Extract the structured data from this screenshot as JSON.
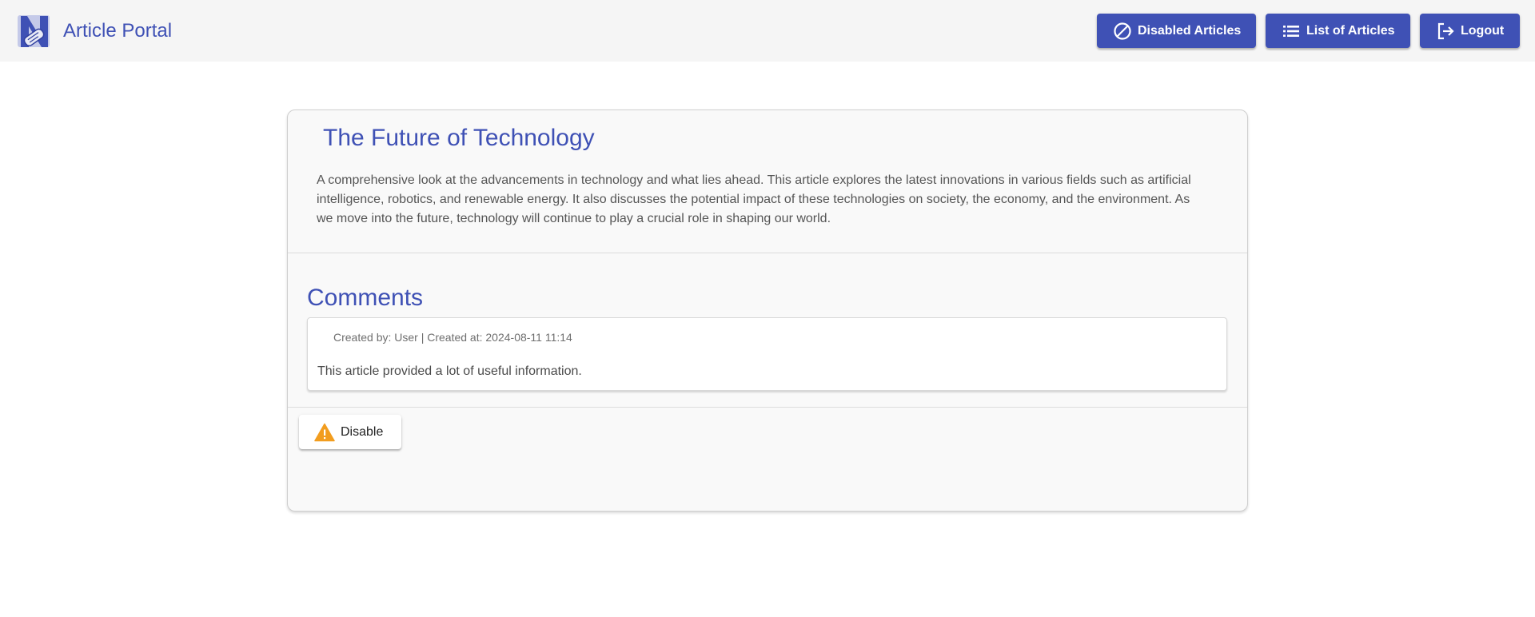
{
  "header": {
    "title": "Article Portal",
    "logo_icon": "newspaper-logo-icon",
    "accent_color": "#3f51b5",
    "buttons": {
      "disabled_articles": {
        "label": "Disabled Articles",
        "icon": "block-icon"
      },
      "list_articles": {
        "label": "List of Articles",
        "icon": "list-icon"
      },
      "logout": {
        "label": "Logout",
        "icon": "logout-icon"
      }
    }
  },
  "article": {
    "title": "The Future of Technology",
    "body": "A comprehensive look at the advancements in technology and what lies ahead. This article explores the latest innovations in various fields such as artificial intelligence, robotics, and renewable energy. It also discusses the potential impact of these technologies on society, the economy, and the environment. As we move into the future, technology will continue to play a crucial role in shaping our world."
  },
  "comments": {
    "heading": "Comments",
    "items": [
      {
        "meta": "Created by: User | Created at: 2024-08-11 11:14",
        "text": "This article provided a lot of useful information."
      }
    ]
  },
  "actions": {
    "disable_label": "Disable",
    "disable_icon": "warning-icon",
    "warning_color": "#f29d1f"
  }
}
